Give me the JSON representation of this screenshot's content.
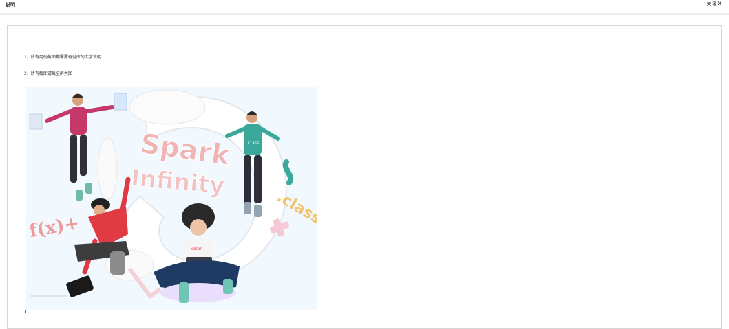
{
  "dialog": {
    "title": "说明",
    "close_label": "关闭",
    "close_icon": "close-icon"
  },
  "content": {
    "notes": [
      "1、所有用例截图都需要有对应的文字说明",
      "2、所有截图请截全屏大图"
    ],
    "illustration": {
      "words": [
        "Spark",
        "Infinity",
        ".class",
        "f(x)+",
        "color",
        "CLASS"
      ],
      "colors": {
        "background": "#f1f8fe",
        "red": "#d8313f",
        "teal": "#3aa89a",
        "pink": "#f1b4b4"
      }
    },
    "caption": "1"
  }
}
